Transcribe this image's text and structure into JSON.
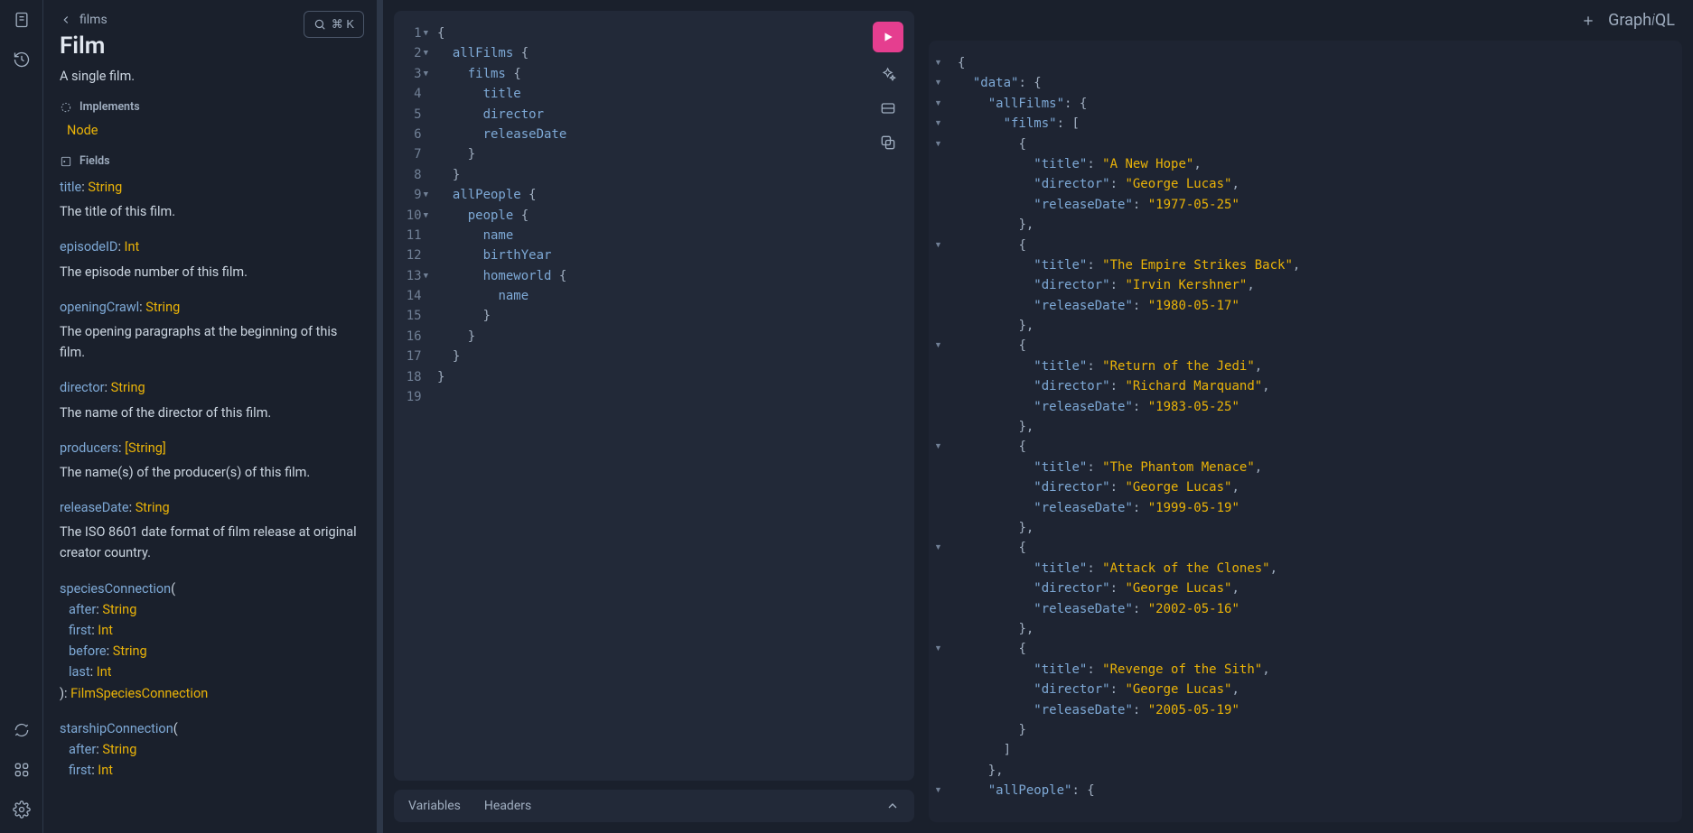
{
  "logo": {
    "part1": "Graph",
    "part2": "i",
    "part3": "QL"
  },
  "search": {
    "shortcut": "⌘ K"
  },
  "breadcrumb": {
    "parent": "films"
  },
  "type": {
    "name": "Film",
    "description": "A single film."
  },
  "sections": {
    "implements": "Implements",
    "fields": "Fields"
  },
  "implements": [
    "Node"
  ],
  "fields": [
    {
      "name": "title",
      "type": "String",
      "desc": "The title of this film."
    },
    {
      "name": "episodeID",
      "type": "Int",
      "desc": "The episode number of this film."
    },
    {
      "name": "openingCrawl",
      "type": "String",
      "desc": "The opening paragraphs at the beginning of this film."
    },
    {
      "name": "director",
      "type": "String",
      "desc": "The name of the director of this film."
    },
    {
      "name": "producers",
      "type": "[String]",
      "desc": "The name(s) of the producer(s) of this film."
    },
    {
      "name": "releaseDate",
      "type": "String",
      "desc": "The ISO 8601 date format of film release at original creator country."
    },
    {
      "name": "speciesConnection",
      "ret": "FilmSpeciesConnection",
      "args": [
        {
          "n": "after",
          "t": "String"
        },
        {
          "n": "first",
          "t": "Int"
        },
        {
          "n": "before",
          "t": "String"
        },
        {
          "n": "last",
          "t": "Int"
        }
      ]
    },
    {
      "name": "starshipConnection",
      "args": [
        {
          "n": "after",
          "t": "String"
        },
        {
          "n": "first",
          "t": "Int"
        }
      ]
    }
  ],
  "query": {
    "lines": [
      {
        "n": 1,
        "f": true,
        "html": "<span class='p'>{</span>"
      },
      {
        "n": 2,
        "f": true,
        "html": "  <span class='fld'>allFilms</span> <span class='p'>{</span>"
      },
      {
        "n": 3,
        "f": true,
        "html": "    <span class='fld'>films</span> <span class='p'>{</span>"
      },
      {
        "n": 4,
        "html": "      <span class='fld'>title</span>"
      },
      {
        "n": 5,
        "html": "      <span class='fld'>director</span>"
      },
      {
        "n": 6,
        "html": "      <span class='fld'>releaseDate</span>"
      },
      {
        "n": 7,
        "html": "    <span class='p'>}</span>"
      },
      {
        "n": 8,
        "html": "  <span class='p'>}</span>"
      },
      {
        "n": 9,
        "f": true,
        "html": "  <span class='fld'>allPeople</span> <span class='p'>{</span>"
      },
      {
        "n": 10,
        "f": true,
        "html": "    <span class='fld'>people</span> <span class='p'>{</span>"
      },
      {
        "n": 11,
        "html": "      <span class='fld'>name</span>"
      },
      {
        "n": 12,
        "html": "      <span class='fld'>birthYear</span>"
      },
      {
        "n": 13,
        "f": true,
        "html": "      <span class='fld'>homeworld</span> <span class='p'>{</span>"
      },
      {
        "n": 14,
        "html": "        <span class='fld'>name</span>"
      },
      {
        "n": 15,
        "html": "      <span class='p'>}</span>"
      },
      {
        "n": 16,
        "html": "    <span class='p'>}</span>"
      },
      {
        "n": 17,
        "html": "  <span class='p'>}</span>"
      },
      {
        "n": 18,
        "html": "<span class='p'>}</span>"
      },
      {
        "n": 19,
        "html": ""
      }
    ]
  },
  "tabs": {
    "variables": "Variables",
    "headers": "Headers"
  },
  "response": {
    "data": {
      "allFilms": {
        "films": [
          {
            "title": "A New Hope",
            "director": "George Lucas",
            "releaseDate": "1977-05-25"
          },
          {
            "title": "The Empire Strikes Back",
            "director": "Irvin Kershner",
            "releaseDate": "1980-05-17"
          },
          {
            "title": "Return of the Jedi",
            "director": "Richard Marquand",
            "releaseDate": "1983-05-25"
          },
          {
            "title": "The Phantom Menace",
            "director": "George Lucas",
            "releaseDate": "1999-05-19"
          },
          {
            "title": "Attack of the Clones",
            "director": "George Lucas",
            "releaseDate": "2002-05-16"
          },
          {
            "title": "Revenge of the Sith",
            "director": "George Lucas",
            "releaseDate": "2005-05-19"
          }
        ]
      },
      "allPeople": {}
    }
  }
}
